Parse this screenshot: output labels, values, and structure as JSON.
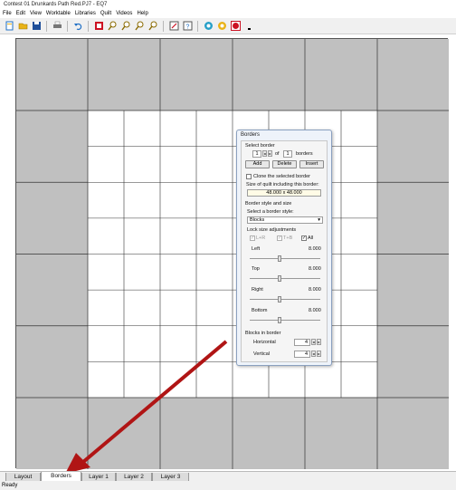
{
  "window": {
    "title": "Contest 01 Drunkards Path Red.PJ7 - EQ7"
  },
  "menu": {
    "items": [
      {
        "label": "File"
      },
      {
        "label": "Edit"
      },
      {
        "label": "View"
      },
      {
        "label": "Worktable"
      },
      {
        "label": "Libraries"
      },
      {
        "label": "Quilt"
      },
      {
        "label": "Videos"
      },
      {
        "label": "Help"
      }
    ]
  },
  "toolbar": {
    "icons": [
      "new-icon",
      "open-icon",
      "save-icon",
      "print-icon",
      "undo-icon",
      "block-icon",
      "zoom-in-icon",
      "zoom-out-icon",
      "zoom-fit-icon",
      "zoom-page-icon",
      "edit-icon",
      "help-icon",
      "color-icon",
      "fabric-icon",
      "palette-icon",
      "more-icon"
    ],
    "colors": {
      "accent_red": "#cc1122",
      "icon_blue": "#1f6fc5",
      "icon_yellow": "#e9b318"
    }
  },
  "tabs": [
    {
      "label": "Layout",
      "active": false
    },
    {
      "label": "Borders",
      "active": true
    },
    {
      "label": "Layer 1",
      "active": false
    },
    {
      "label": "Layer 2",
      "active": false
    },
    {
      "label": "Layer 3",
      "active": false
    }
  ],
  "status": {
    "text": "Ready"
  },
  "borders_dialog": {
    "title": "Borders",
    "select_border": {
      "heading": "Select border",
      "current": "1",
      "of_label": "of",
      "total": "1",
      "suffix": "borders",
      "add": "Add",
      "delete": "Delete",
      "insert": "Insert"
    },
    "clone_label": "Clone the selected border",
    "size": {
      "heading": "Size of quilt including this border:",
      "value": "48.000 x 48.000"
    },
    "style": {
      "heading": "Border style and size",
      "select_label": "Select a border style:",
      "selected": "Blocks"
    },
    "lock": {
      "heading": "Lock size adjustments",
      "lr": "L+R",
      "tb": "T+B",
      "all": "All",
      "all_checked": true
    },
    "sides": [
      {
        "label": "Left",
        "value": "8.000",
        "slider": 0.5
      },
      {
        "label": "Top",
        "value": "8.000",
        "slider": 0.5
      },
      {
        "label": "Right",
        "value": "8.000",
        "slider": 0.5
      },
      {
        "label": "Bottom",
        "value": "8.000",
        "slider": 0.5
      }
    ],
    "blocks_in_border": {
      "heading": "Blocks in border",
      "horizontal_label": "Horizontal",
      "horizontal": "4",
      "vertical_label": "Vertical",
      "vertical": "4"
    }
  },
  "quilt": {
    "border_color": "#c0c0c0",
    "center_color": "#ffffff",
    "line_color": "#333333"
  },
  "annotation": {
    "arrow_color": "#b01515"
  }
}
